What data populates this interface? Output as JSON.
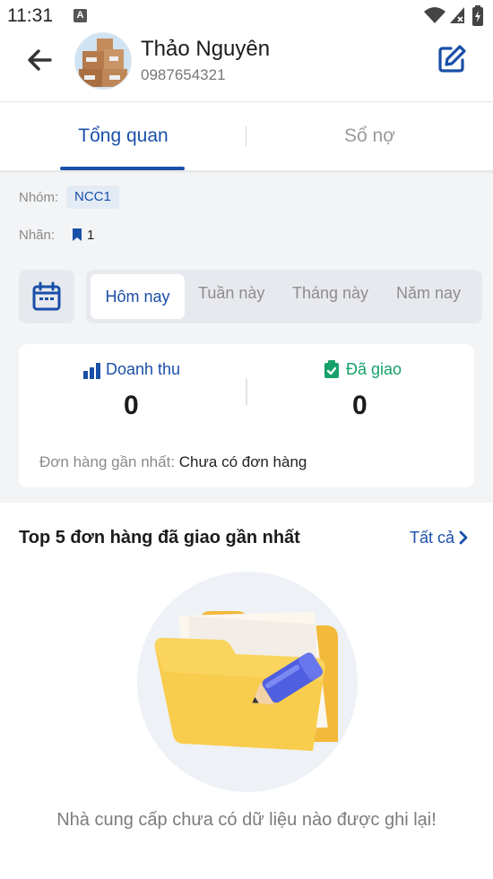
{
  "status_bar": {
    "time": "11:31",
    "notif_icon": "A"
  },
  "header": {
    "name": "Thảo Nguyên",
    "phone": "0987654321",
    "back_icon": "arrow-left-icon",
    "edit_icon": "edit-icon"
  },
  "tabs": [
    {
      "label": "Tổng quan",
      "active": true
    },
    {
      "label": "Sổ nợ",
      "active": false
    }
  ],
  "info": {
    "group_label": "Nhóm:",
    "group_value": "NCC1",
    "tag_label": "Nhãn:",
    "tag_count": "1"
  },
  "period": {
    "options": [
      "Hôm nay",
      "Tuần này",
      "Tháng này",
      "Năm nay"
    ],
    "selected": "Hôm nay"
  },
  "stats": {
    "revenue_label": "Doanh thu",
    "revenue_value": "0",
    "delivered_label": "Đã giao",
    "delivered_value": "0",
    "recent_label": "Đơn hàng gần nhất:",
    "recent_value": "Chưa có đơn hàng"
  },
  "orders": {
    "title": "Top 5 đơn hàng đã giao gần nhất",
    "see_all": "Tất cả",
    "empty_text": "Nhà cung cấp chưa có dữ liệu nào được ghi lại!"
  },
  "colors": {
    "primary": "#1a4fa8",
    "success": "#17a06a",
    "background_grey": "#f3f4f6",
    "folder": "#f7c744"
  }
}
